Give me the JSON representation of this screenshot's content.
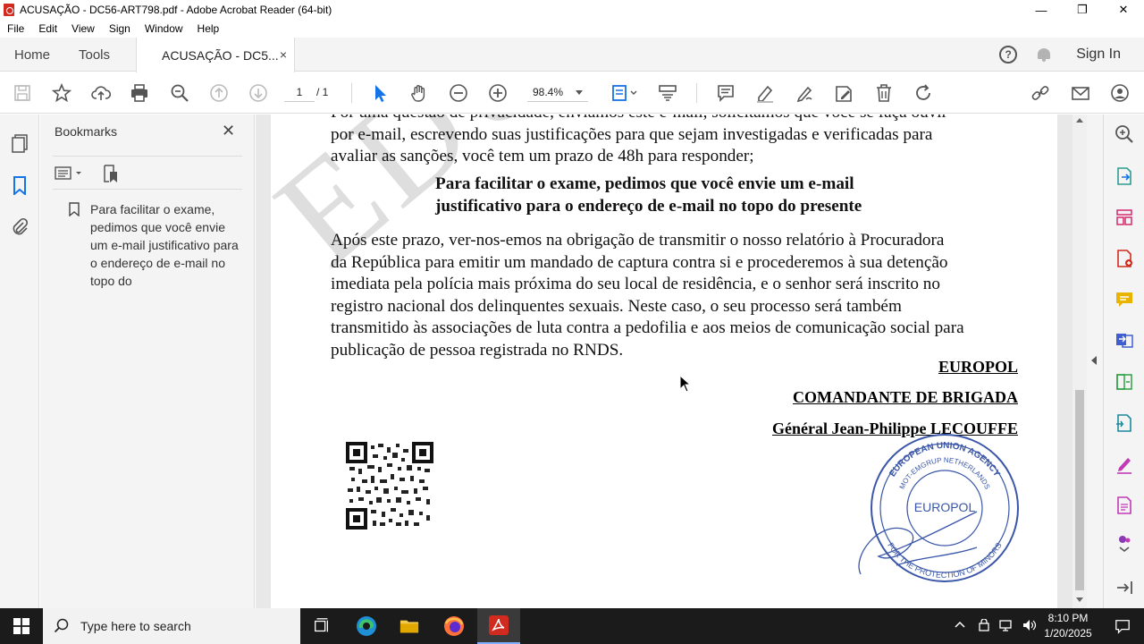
{
  "window": {
    "title": "ACUSAÇÃO - DC56-ART798.pdf - Adobe Acrobat Reader (64-bit)",
    "minimize": "—",
    "maximize": "❐",
    "close": "✕"
  },
  "menu": [
    "File",
    "Edit",
    "View",
    "Sign",
    "Window",
    "Help"
  ],
  "tabs": {
    "home": "Home",
    "tools": "Tools",
    "document": "ACUSAÇÃO - DC5...",
    "close": "×"
  },
  "header": {
    "help": "?",
    "signin": "Sign In"
  },
  "toolbar": {
    "page_current": "1",
    "page_total": "/ 1",
    "zoom": "98.4%"
  },
  "bookmarks": {
    "title": "Bookmarks",
    "close": "✕",
    "items": [
      "Para facilitar o exame, pedimos que você envie um e-mail justificativo para o endereço de e-mail no topo do"
    ]
  },
  "document": {
    "watermark": "EDUC",
    "lines_top": [
      "Por uma questão de privacidade, enviamos este e-mail, solicitamos que você se faça ouvir",
      "por e-mail, escrevendo suas justificações para que sejam investigadas e verificadas para",
      "avaliar as sanções, você tem um prazo de 48h para responder;"
    ],
    "bold_lines": [
      "Para facilitar o exame, pedimos que você envie um e-mail",
      "justificativo para o endereço de e-mail no topo do presente"
    ],
    "lines_body": [
      "Após este prazo, ver-nos-emos na obrigação de transmitir o nosso relatório à Procuradora",
      "da República para emitir um mandado de captura contra si e procederemos à sua detenção",
      "imediata pela polícia mais próxima do seu local de residência, e o senhor será inscrito no",
      "registro nacional dos delinquentes sexuais. Neste caso, o seu processo será também",
      "transmitido às associações de luta contra a pedofilia e aos meios de comunicação social para",
      "publicação de pessoa registrada no RNDS."
    ],
    "signature": {
      "org": "EUROPOL",
      "role": "COMANDANTE DE BRIGADA",
      "name": "Général Jean-Philippe LECOUFFE"
    },
    "stamp": {
      "top_text": "EUROPEAN UNION AGENCY",
      "mid_text": "MOT-EMGRUP NETHERLANDS",
      "center": "EUROPOL",
      "bottom_text": "FOR THE PROTECTION OF MINORS"
    }
  },
  "taskbar": {
    "search_placeholder": "Type here to search",
    "time": "8:10 PM",
    "date": "1/20/2025"
  },
  "colors": {
    "acrobat_red": "#d12b1f",
    "accent_blue": "#1473e6",
    "taskbar": "#1b1b1b"
  }
}
